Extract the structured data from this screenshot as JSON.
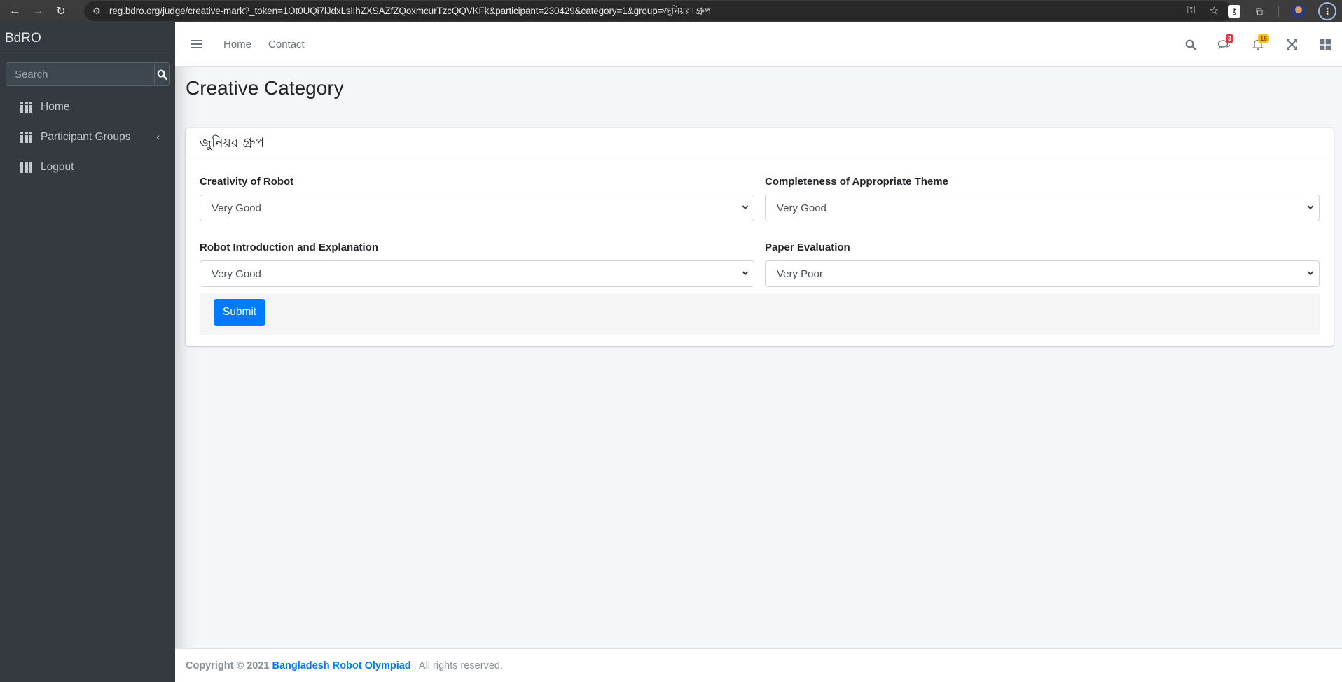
{
  "browser": {
    "url": "reg.bdro.org/judge/creative-mark?_token=1Ot0UQi7lJdxLslIhZXSAZfZQoxmcurTzcQQVKFk&participant=230429&category=1&group=জুনিয়র+গ্রুপ",
    "icons": {
      "back": "←",
      "forward": "→",
      "reload": "↻",
      "site_info": "⚙",
      "password_key": "⚿",
      "bookmark": "☆",
      "extension_key": "⚷",
      "extensions": "⧉",
      "menu": "⋮"
    }
  },
  "sidebar": {
    "brand": "BdRO",
    "search_placeholder": "Search",
    "items": [
      {
        "label": "Home",
        "icon": "grid-icon"
      },
      {
        "label": "Participant Groups",
        "icon": "grid-icon",
        "has_submenu": true
      },
      {
        "label": "Logout",
        "icon": "grid-icon"
      }
    ],
    "chevron": "‹"
  },
  "topnav": {
    "links": [
      "Home",
      "Contact"
    ],
    "messages_count": "3",
    "notifications_count": "15"
  },
  "page": {
    "title": "Creative Category",
    "card_title": "জুনিয়র গ্রুপ",
    "fields": [
      {
        "label": "Creativity of Robot",
        "value": "Very Good"
      },
      {
        "label": "Completeness of Appropriate Theme",
        "value": "Very Good"
      },
      {
        "label": "Robot Introduction and Explanation",
        "value": "Very Good"
      },
      {
        "label": "Paper Evaluation",
        "value": "Very Poor"
      }
    ],
    "submit_label": "Submit"
  },
  "footer": {
    "copyright": "Copyright © 2021",
    "org": "Bangladesh Robot Olympiad",
    "suffix": ". All rights reserved."
  },
  "colors": {
    "primary": "#007bff",
    "sidebar_bg": "#343a40",
    "badge_danger": "#dc3545",
    "badge_warning": "#ffc107"
  }
}
